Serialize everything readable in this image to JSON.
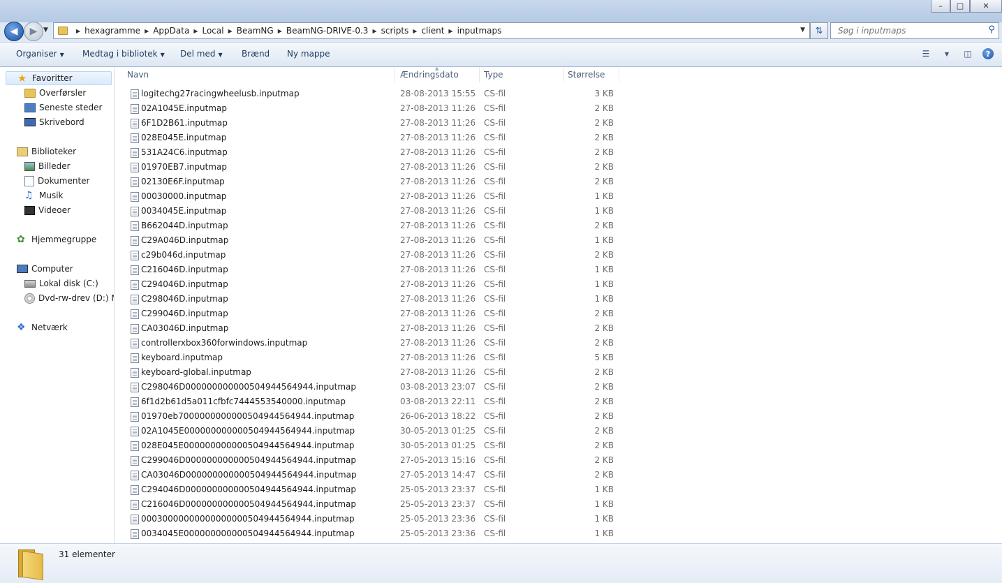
{
  "window": {
    "minimize_glyph": "–",
    "maximize_glyph": "□",
    "close_glyph": "✕"
  },
  "address_bar": {
    "breadcrumbs": [
      "hexagramme",
      "AppData",
      "Local",
      "BeamNG",
      "BeamNG-DRIVE-0.3",
      "scripts",
      "client",
      "inputmaps"
    ],
    "separator": "▶"
  },
  "search": {
    "placeholder": "Søg i inputmaps"
  },
  "toolbar": {
    "organize": "Organiser",
    "include_library": "Medtag i bibliotek",
    "share": "Del med",
    "burn": "Brænd",
    "new_folder": "Ny mappe"
  },
  "sidebar": {
    "favorites": {
      "label": "Favoritter",
      "items": [
        "Overførsler",
        "Seneste steder",
        "Skrivebord"
      ]
    },
    "libraries": {
      "label": "Biblioteker",
      "items": [
        "Billeder",
        "Dokumenter",
        "Musik",
        "Videoer"
      ]
    },
    "homegroup": "Hjemmegruppe",
    "computer": {
      "label": "Computer",
      "items": [
        "Lokal disk (C:)",
        "Dvd-rw-drev (D:) NC"
      ]
    },
    "network": "Netværk"
  },
  "columns": {
    "name": "Navn",
    "date": "Ændringsdato",
    "type": "Type",
    "size": "Størrelse"
  },
  "files": [
    {
      "name": "logitechg27racingwheelusb.inputmap",
      "date": "28-08-2013 15:55",
      "type": "CS-fil",
      "size": "3 KB"
    },
    {
      "name": "02A1045E.inputmap",
      "date": "27-08-2013 11:26",
      "type": "CS-fil",
      "size": "2 KB"
    },
    {
      "name": "6F1D2B61.inputmap",
      "date": "27-08-2013 11:26",
      "type": "CS-fil",
      "size": "2 KB"
    },
    {
      "name": "028E045E.inputmap",
      "date": "27-08-2013 11:26",
      "type": "CS-fil",
      "size": "2 KB"
    },
    {
      "name": "531A24C6.inputmap",
      "date": "27-08-2013 11:26",
      "type": "CS-fil",
      "size": "2 KB"
    },
    {
      "name": "01970EB7.inputmap",
      "date": "27-08-2013 11:26",
      "type": "CS-fil",
      "size": "2 KB"
    },
    {
      "name": "02130E6F.inputmap",
      "date": "27-08-2013 11:26",
      "type": "CS-fil",
      "size": "2 KB"
    },
    {
      "name": "00030000.inputmap",
      "date": "27-08-2013 11:26",
      "type": "CS-fil",
      "size": "1 KB"
    },
    {
      "name": "0034045E.inputmap",
      "date": "27-08-2013 11:26",
      "type": "CS-fil",
      "size": "1 KB"
    },
    {
      "name": "B662044D.inputmap",
      "date": "27-08-2013 11:26",
      "type": "CS-fil",
      "size": "2 KB"
    },
    {
      "name": "C29A046D.inputmap",
      "date": "27-08-2013 11:26",
      "type": "CS-fil",
      "size": "1 KB"
    },
    {
      "name": "c29b046d.inputmap",
      "date": "27-08-2013 11:26",
      "type": "CS-fil",
      "size": "2 KB"
    },
    {
      "name": "C216046D.inputmap",
      "date": "27-08-2013 11:26",
      "type": "CS-fil",
      "size": "1 KB"
    },
    {
      "name": "C294046D.inputmap",
      "date": "27-08-2013 11:26",
      "type": "CS-fil",
      "size": "1 KB"
    },
    {
      "name": "C298046D.inputmap",
      "date": "27-08-2013 11:26",
      "type": "CS-fil",
      "size": "1 KB"
    },
    {
      "name": "C299046D.inputmap",
      "date": "27-08-2013 11:26",
      "type": "CS-fil",
      "size": "2 KB"
    },
    {
      "name": "CA03046D.inputmap",
      "date": "27-08-2013 11:26",
      "type": "CS-fil",
      "size": "2 KB"
    },
    {
      "name": "controllerxbox360forwindows.inputmap",
      "date": "27-08-2013 11:26",
      "type": "CS-fil",
      "size": "2 KB"
    },
    {
      "name": "keyboard.inputmap",
      "date": "27-08-2013 11:26",
      "type": "CS-fil",
      "size": "5 KB"
    },
    {
      "name": "keyboard-global.inputmap",
      "date": "27-08-2013 11:26",
      "type": "CS-fil",
      "size": "2 KB"
    },
    {
      "name": "C298046D000000000000504944564944.inputmap",
      "date": "03-08-2013 23:07",
      "type": "CS-fil",
      "size": "2 KB"
    },
    {
      "name": "6f1d2b61d5a011cfbfc7444553540000.inputmap",
      "date": "03-08-2013 22:11",
      "type": "CS-fil",
      "size": "2 KB"
    },
    {
      "name": "01970eb7000000000000504944564944.inputmap",
      "date": "26-06-2013 18:22",
      "type": "CS-fil",
      "size": "2 KB"
    },
    {
      "name": "02A1045E000000000000504944564944.inputmap",
      "date": "30-05-2013 01:25",
      "type": "CS-fil",
      "size": "2 KB"
    },
    {
      "name": "028E045E000000000000504944564944.inputmap",
      "date": "30-05-2013 01:25",
      "type": "CS-fil",
      "size": "2 KB"
    },
    {
      "name": "C299046D000000000000504944564944.inputmap",
      "date": "27-05-2013 15:16",
      "type": "CS-fil",
      "size": "2 KB"
    },
    {
      "name": "CA03046D000000000000504944564944.inputmap",
      "date": "27-05-2013 14:47",
      "type": "CS-fil",
      "size": "2 KB"
    },
    {
      "name": "C294046D000000000000504944564944.inputmap",
      "date": "25-05-2013 23:37",
      "type": "CS-fil",
      "size": "1 KB"
    },
    {
      "name": "C216046D000000000000504944564944.inputmap",
      "date": "25-05-2013 23:37",
      "type": "CS-fil",
      "size": "1 KB"
    },
    {
      "name": "00030000000000000000504944564944.inputmap",
      "date": "25-05-2013 23:36",
      "type": "CS-fil",
      "size": "1 KB"
    },
    {
      "name": "0034045E000000000000504944564944.inputmap",
      "date": "25-05-2013 23:36",
      "type": "CS-fil",
      "size": "1 KB"
    }
  ],
  "details": {
    "item_count": "31 elementer"
  },
  "colors": {
    "accent": "#1d4f9c",
    "selection": "#dbeafb",
    "header_text": "#4c607a",
    "secondary_text": "#6d6d6d"
  }
}
